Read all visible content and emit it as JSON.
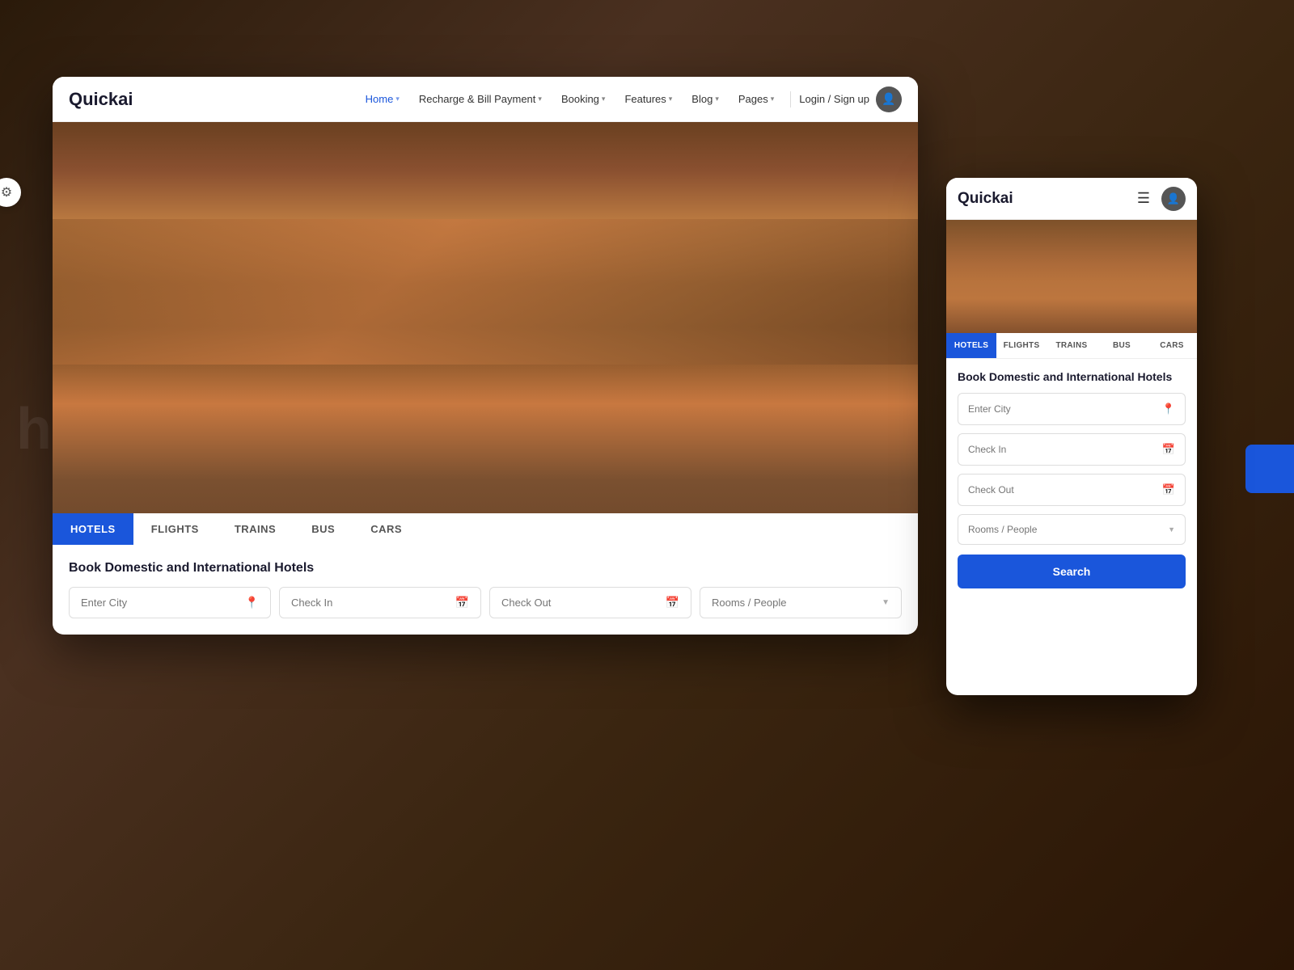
{
  "background": {
    "color": "#3a2010"
  },
  "desktop": {
    "brand": "Quickai",
    "nav": {
      "links": [
        {
          "label": "Home",
          "active": true,
          "hasChevron": true
        },
        {
          "label": "Recharge & Bill Payment",
          "active": false,
          "hasChevron": true
        },
        {
          "label": "Booking",
          "active": false,
          "hasChevron": true
        },
        {
          "label": "Features",
          "active": false,
          "hasChevron": true
        },
        {
          "label": "Blog",
          "active": false,
          "hasChevron": true
        },
        {
          "label": "Pages",
          "active": false,
          "hasChevron": true
        }
      ],
      "login_label": "Login / Sign up"
    },
    "tabs": [
      {
        "label": "HOTELS",
        "active": true
      },
      {
        "label": "FLIGHTS",
        "active": false
      },
      {
        "label": "TRAINS",
        "active": false
      },
      {
        "label": "BUS",
        "active": false
      },
      {
        "label": "CARS",
        "active": false
      }
    ],
    "search": {
      "title": "Book Domestic and International Hotels",
      "city_placeholder": "Enter City",
      "checkin_placeholder": "Check In",
      "checkout_placeholder": "Check Out",
      "rooms_placeholder": "Rooms / People"
    }
  },
  "mobile": {
    "brand": "Quickai",
    "tabs": [
      {
        "label": "HOTELS",
        "active": true
      },
      {
        "label": "FLIGHTS",
        "active": false
      },
      {
        "label": "TRAINS",
        "active": false
      },
      {
        "label": "BUS",
        "active": false
      },
      {
        "label": "CARS",
        "active": false
      }
    ],
    "search": {
      "title": "Book Domestic and International Hotels",
      "city_placeholder": "Enter City",
      "checkin_placeholder": "Check In",
      "checkout_placeholder": "Check Out",
      "rooms_placeholder": "Rooms / People",
      "search_button": "Search"
    }
  }
}
